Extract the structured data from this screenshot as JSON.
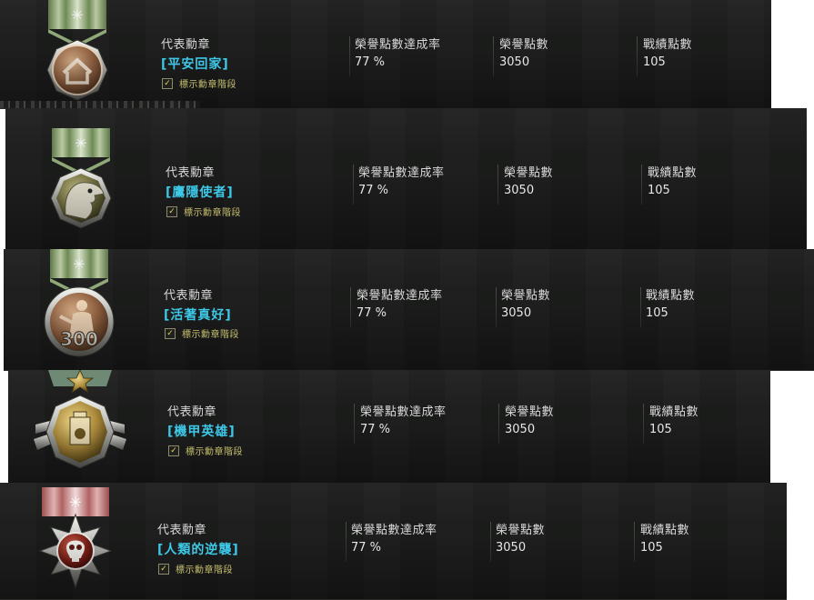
{
  "labels": {
    "representative_medal": "代表勳章",
    "honor_rate": "榮譽點數達成率",
    "honor_points": "榮譽點數",
    "battle_points": "戰績點數",
    "show_medal_tier": "標示勳章階段"
  },
  "cards": [
    {
      "medal_name": "[平安回家]",
      "honor_rate": "77 %",
      "honor_points": "3050",
      "battle_points": "105",
      "show_tier_checked": true,
      "medal_icon": "home-return-medal-icon",
      "ribbon_color": "#7c9a5f"
    },
    {
      "medal_name": "[鷹隱使者]",
      "honor_rate": "77 %",
      "honor_points": "3050",
      "battle_points": "105",
      "show_tier_checked": true,
      "medal_icon": "eagle-head-medal-icon",
      "ribbon_color": "#7c9a5f"
    },
    {
      "medal_name": "[活著真好]",
      "honor_rate": "77 %",
      "honor_points": "3050",
      "battle_points": "105",
      "show_tier_checked": true,
      "medal_icon": "soldier-300-medal-icon",
      "ribbon_color": "#7c9a5f"
    },
    {
      "medal_name": "[機甲英雄]",
      "honor_rate": "77 %",
      "honor_points": "3050",
      "battle_points": "105",
      "show_tier_checked": true,
      "medal_icon": "mech-hero-medal-icon",
      "ribbon_color": "#7c9a5f"
    },
    {
      "medal_name": "[人類的逆襲]",
      "honor_rate": "77 %",
      "honor_points": "3050",
      "battle_points": "105",
      "show_tier_checked": true,
      "medal_icon": "skull-medal-icon",
      "ribbon_color": "#b86a6a"
    }
  ]
}
